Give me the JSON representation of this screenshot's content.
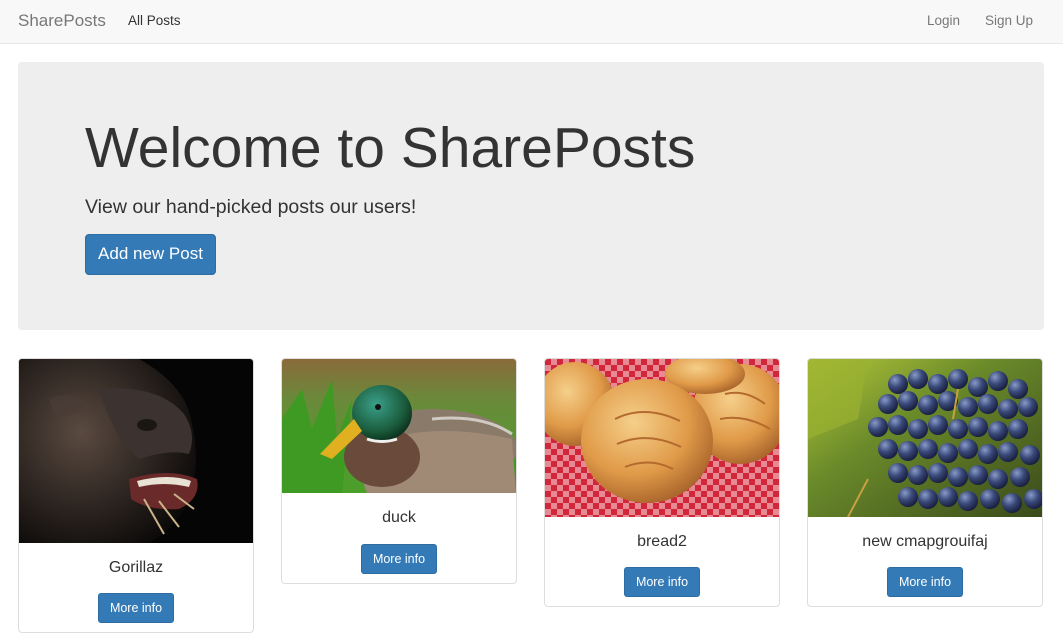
{
  "navbar": {
    "brand": "SharePosts",
    "links": {
      "all_posts": "All Posts",
      "login": "Login",
      "signup": "Sign Up"
    }
  },
  "jumbotron": {
    "title": "Welcome to SharePosts",
    "lead": "View our hand-picked posts our users!",
    "button": "Add new Post"
  },
  "posts": [
    {
      "title": "Gorillaz",
      "button": "More info"
    },
    {
      "title": "duck",
      "button": "More info"
    },
    {
      "title": "bread2",
      "button": "More info"
    },
    {
      "title": "new cmapgrouifaj",
      "button": "More info"
    }
  ],
  "colors": {
    "primary": "#337ab7",
    "navbar_bg": "#f8f8f8",
    "jumbotron_bg": "#eeeeee"
  }
}
